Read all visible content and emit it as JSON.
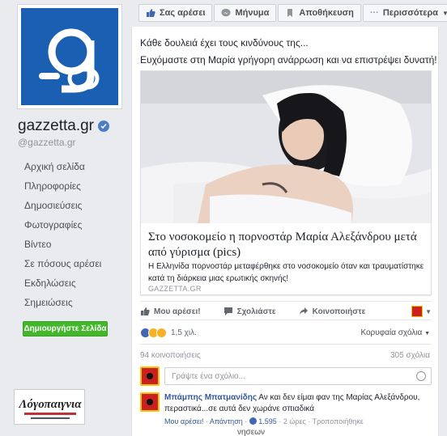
{
  "page": {
    "name": "gazzetta.gr",
    "handle": "@gazzetta.gr",
    "nav": [
      {
        "label": "Αρχική σελίδα"
      },
      {
        "label": "Πληροφορίες"
      },
      {
        "label": "Δημοσιεύσεις"
      },
      {
        "label": "Φωτογραφίες"
      },
      {
        "label": "Βίντεο"
      },
      {
        "label": "Σε πόσους αρέσει"
      },
      {
        "label": "Εκδηλώσεις"
      },
      {
        "label": "Σημειώσεις"
      }
    ],
    "create_page_label": "Δημιουργήστε Σελίδα",
    "ad_logo_text": "Λόγοπαιγνια"
  },
  "actionbar": {
    "like": "Σας αρέσει",
    "message": "Μήνυμα",
    "save": "Αποθήκευση",
    "more": "Περισσότερα"
  },
  "post": {
    "text_line1": "Κάθε δουλειά έχει τους κινδύνους της...",
    "text_line2": "Ευχόμαστε στη Μαρία γρήγορη ανάρρωση και να επιστρέψει δυνατή!",
    "link_title": "Στο νοσοκομείο η πορνοστάρ Μαρία Αλεξάνδρου μετά από γύρισμα (pics)",
    "link_desc": "Η Ελληνίδα πορνοστάρ μεταφέρθηκε στο νοσοκομείο όταν και τραυματίστηκε κατά τη διάρκεια μιας ερωτικής σκηνής!",
    "link_source": "GAZZETTA.GR",
    "actions": {
      "like": "Μου αρέσει!",
      "comment": "Σχολιάστε",
      "share": "Κοινοποιήστε"
    },
    "reactions_count": "1,5 χιλ.",
    "sort_label": "Κορυφαία σχόλια",
    "shares": "94 κοινοποιήσεις",
    "comments": "305 σχόλια",
    "comment_placeholder": "Γράψτε ένα σχόλιο...",
    "comment": {
      "author": "Μπάμπης Μπατμανίδης",
      "text": "Αν και δεν είμαι φαν της Μαρίας Αλεξάνδρου, περαστικά...σε αυτά δεν χωράνε σπιαδικά",
      "like": "Μου αρέσει!",
      "reply": "Απάντηση",
      "likes": "1.595",
      "time": "2 ώρες",
      "edited": "Τροποποιήθηκε"
    },
    "more_replies": "νησεων"
  },
  "colors": {
    "brand_blue": "#1b5fb3",
    "link": "#365899",
    "green": "#42b72a"
  }
}
